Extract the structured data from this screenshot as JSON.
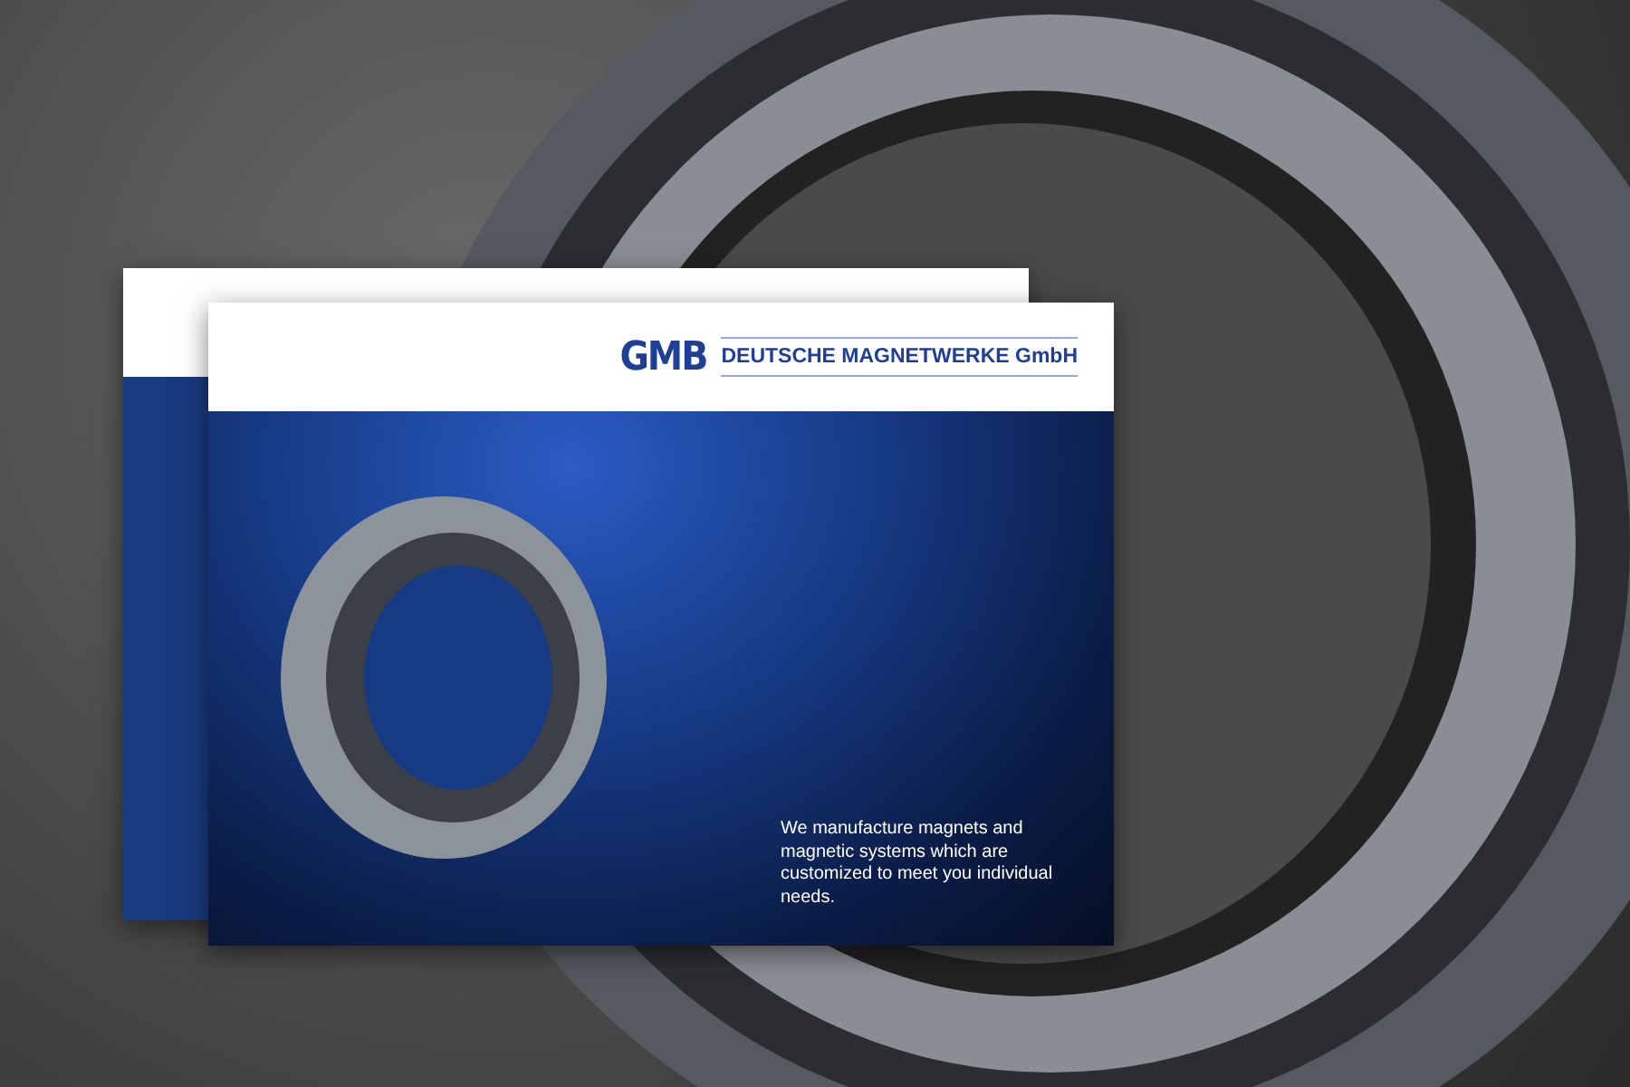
{
  "brochure": {
    "logo": "GMB",
    "company": "DEUTSCHE MAGNETWERKE GmbH",
    "tagline": "We manufacture magnets and magnetic systems which are customized to meet you individual needs."
  }
}
